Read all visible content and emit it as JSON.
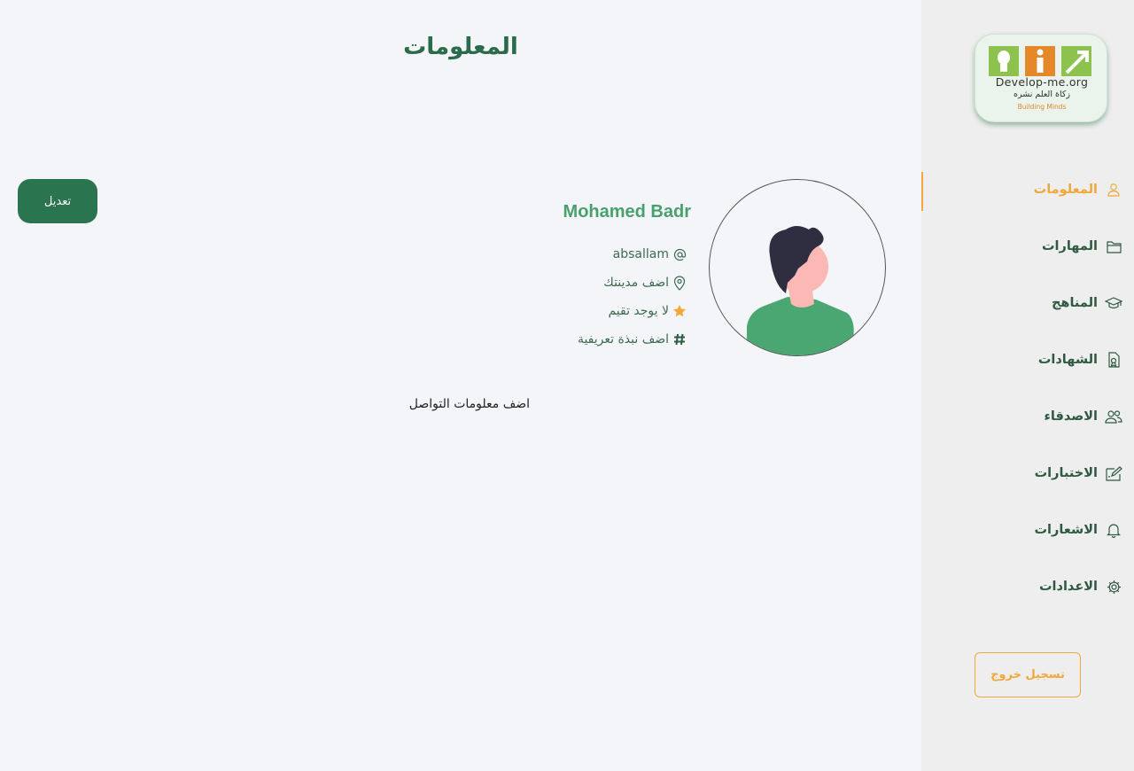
{
  "header": {
    "title": "المعلومات"
  },
  "logo": {
    "url_text": "Develop-me.org",
    "arabic_text": "زكاة العلم نشره",
    "tagline": "Building Minds"
  },
  "sidebar": {
    "items": [
      {
        "label": "المعلومات",
        "icon": "user-icon",
        "active": true
      },
      {
        "label": "المهارات",
        "icon": "folder-icon",
        "active": false
      },
      {
        "label": "المناهج",
        "icon": "graduation-cap-icon",
        "active": false
      },
      {
        "label": "الشهادات",
        "icon": "certificate-icon",
        "active": false
      },
      {
        "label": "الاصدقاء",
        "icon": "users-icon",
        "active": false
      },
      {
        "label": "الاختبارات",
        "icon": "edit-icon",
        "active": false
      },
      {
        "label": "الاشعارات",
        "icon": "bell-icon",
        "active": false
      },
      {
        "label": "الاعدادات",
        "icon": "gear-icon",
        "active": false
      }
    ],
    "logout_label": "تسجيل خروج"
  },
  "profile": {
    "edit_label": "تعديل",
    "name": "Mohamed Badr",
    "username": "absallam",
    "city": "اضف مدينتك",
    "rating": "لا يوجد تقيم",
    "bio": "اضف نبذة تعريفية",
    "contact": "اضف معلومات التواصل"
  },
  "colors": {
    "accent": "#f3a73b",
    "primary": "#2b7450",
    "name": "#4aa06d"
  }
}
